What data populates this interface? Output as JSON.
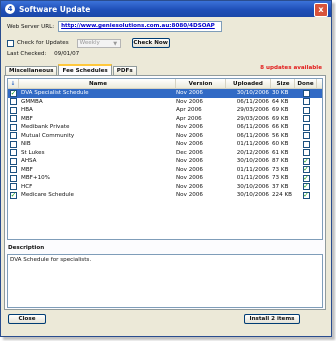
{
  "window": {
    "title": "Software Update",
    "close_glyph": "x"
  },
  "web_server": {
    "label": "Web Server URL:",
    "url": "http://www.geniesolutions.com.au:8080/4DSOAP"
  },
  "check_updates": {
    "label": "Check for Updates",
    "checked": false,
    "frequency": "Weekly",
    "check_now_label": "Check Now"
  },
  "last_checked": {
    "label": "Last Checked:",
    "value": "09/01/07"
  },
  "updates_available": "8 updates available",
  "tabs": [
    {
      "label": "Miscellaneous",
      "active": false
    },
    {
      "label": "Fee Schedules",
      "active": true
    },
    {
      "label": "PDFs",
      "active": false
    }
  ],
  "table": {
    "headers": {
      "check": "",
      "name": "Name",
      "version": "Version",
      "uploaded": "Uploaded",
      "size": "Size",
      "done": "Done"
    },
    "rows": [
      {
        "checked": true,
        "name": "DVA Specialist Schedule",
        "version": "Nov 2006",
        "uploaded": "30/10/2006",
        "size": "30 KB",
        "done": false,
        "selected": true
      },
      {
        "checked": false,
        "name": "GMMBA",
        "version": "Nov 2006",
        "uploaded": "06/11/2006",
        "size": "64 KB",
        "done": false,
        "selected": false
      },
      {
        "checked": false,
        "name": "HBA",
        "version": "Apr 2006",
        "uploaded": "29/03/2006",
        "size": "69 KB",
        "done": false,
        "selected": false
      },
      {
        "checked": false,
        "name": "MBF",
        "version": "Apr 2006",
        "uploaded": "29/03/2006",
        "size": "69 KB",
        "done": false,
        "selected": false
      },
      {
        "checked": false,
        "name": "Medibank Private",
        "version": "Nov 2006",
        "uploaded": "06/11/2006",
        "size": "66 KB",
        "done": false,
        "selected": false
      },
      {
        "checked": false,
        "name": "Mutual Community",
        "version": "Nov 2006",
        "uploaded": "06/11/2006",
        "size": "56 KB",
        "done": false,
        "selected": false
      },
      {
        "checked": false,
        "name": "NIB",
        "version": "Nov 2006",
        "uploaded": "01/11/2006",
        "size": "60 KB",
        "done": false,
        "selected": false
      },
      {
        "checked": false,
        "name": "St Lukes",
        "version": "Dec 2006",
        "uploaded": "20/12/2006",
        "size": "61 KB",
        "done": false,
        "selected": false
      },
      {
        "checked": false,
        "name": "AHSA",
        "version": "Nov 2006",
        "uploaded": "30/10/2006",
        "size": "87 KB",
        "done": true,
        "selected": false
      },
      {
        "checked": false,
        "name": "MBF",
        "version": "Nov 2006",
        "uploaded": "01/11/2006",
        "size": "73 KB",
        "done": true,
        "selected": false
      },
      {
        "checked": false,
        "name": "MBF+10%",
        "version": "Nov 2006",
        "uploaded": "01/11/2006",
        "size": "73 KB",
        "done": true,
        "selected": false
      },
      {
        "checked": false,
        "name": "HCF",
        "version": "Nov 2006",
        "uploaded": "30/10/2006",
        "size": "37 KB",
        "done": true,
        "selected": false
      },
      {
        "checked": true,
        "name": "Medicare Schedule",
        "version": "Nov 2006",
        "uploaded": "30/10/2006",
        "size": "224 KB",
        "done": true,
        "selected": false
      }
    ]
  },
  "description": {
    "label": "Description",
    "text": "DVA Schedule for specialists."
  },
  "buttons": {
    "close": "Close",
    "install": "Install 2 items"
  },
  "colors": {
    "titlebar": "#1f4fb8",
    "selected_row": "#316ac5",
    "updates_text": "#e21b1b",
    "url_text": "#0000cc"
  }
}
